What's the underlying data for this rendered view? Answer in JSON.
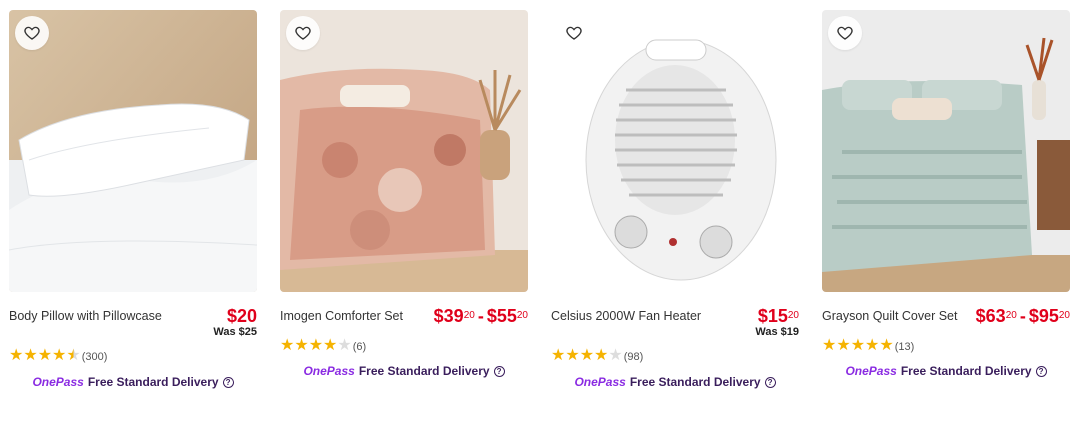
{
  "products": [
    {
      "title": "Body Pillow with Pillowcase",
      "price_main": "$20",
      "was": "Was $25",
      "rating_count": "(300)",
      "stars": 4.5,
      "onepass_label": "OnePass",
      "delivery_label": "Free Standard Delivery",
      "icons": [
        "heart-icon",
        "info-icon"
      ]
    },
    {
      "title": "Imogen Comforter Set",
      "price_low_dollars": "$39",
      "price_low_cents": "20",
      "price_high_dollars": "$55",
      "price_high_cents": "20",
      "price_sep": "-",
      "rating_count": "(6)",
      "stars": 4,
      "onepass_label": "OnePass",
      "delivery_label": "Free Standard Delivery"
    },
    {
      "title": "Celsius 2000W Fan Heater",
      "price_dollars": "$15",
      "price_cents": "20",
      "was": "Was $19",
      "rating_count": "(98)",
      "stars": 4,
      "onepass_label": "OnePass",
      "delivery_label": "Free Standard Delivery"
    },
    {
      "title": "Grayson Quilt Cover Set",
      "price_low_dollars": "$63",
      "price_low_cents": "20",
      "price_high_dollars": "$95",
      "price_high_cents": "20",
      "price_sep": "-",
      "rating_count": "(13)",
      "stars": 5,
      "onepass_label": "OnePass",
      "delivery_label": "Free Standard Delivery"
    }
  ],
  "colors": {
    "price_red": "#e0001b",
    "star_gold": "#f5b301",
    "onepass_purple": "#8a2be2",
    "delivery_text": "#3a1e5c"
  }
}
